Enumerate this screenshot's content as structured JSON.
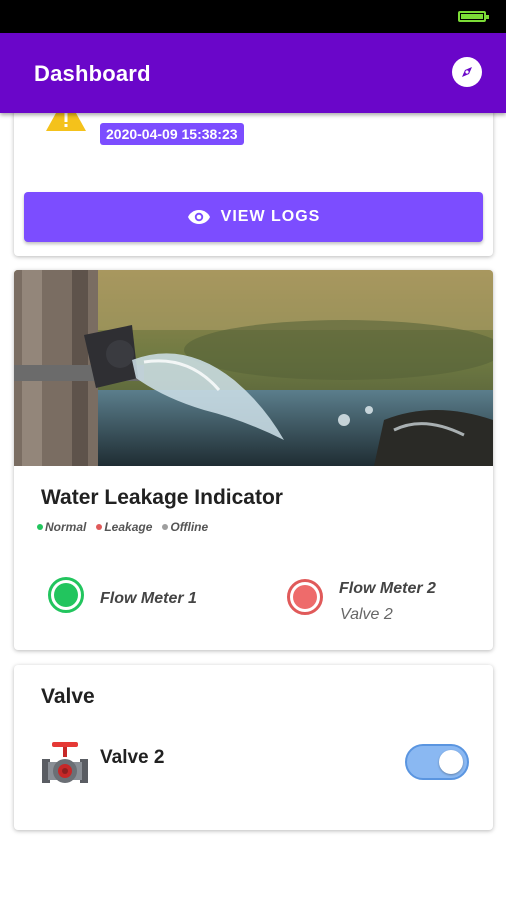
{
  "app_bar": {
    "title": "Dashboard",
    "action_icon": "compass-icon"
  },
  "alert_card": {
    "icon": "warning-icon",
    "timestamp": "2020-04-09 15:38:23",
    "button_label": "VIEW LOGS",
    "button_icon": "eye-icon"
  },
  "leak_card": {
    "title": "Water Leakage Indicator",
    "legend": [
      {
        "label": "Normal",
        "color": "#22c55e"
      },
      {
        "label": "Leakage",
        "color": "#e05a5a"
      },
      {
        "label": "Offline",
        "color": "#9e9e9e"
      }
    ],
    "meters": [
      {
        "name": "Flow Meter 1",
        "status": "Normal",
        "status_color": "#22c55e"
      },
      {
        "name": "Flow Meter 2",
        "valve": "Valve 2",
        "status": "Leakage",
        "status_color": "#ee6b6b"
      }
    ]
  },
  "valve_card": {
    "title": "Valve",
    "items": [
      {
        "name": "Valve 2",
        "state": "on"
      }
    ]
  },
  "colors": {
    "primary": "#6a06c9",
    "accent": "#7c4dff",
    "toggle_on": "#8ab8f2"
  }
}
